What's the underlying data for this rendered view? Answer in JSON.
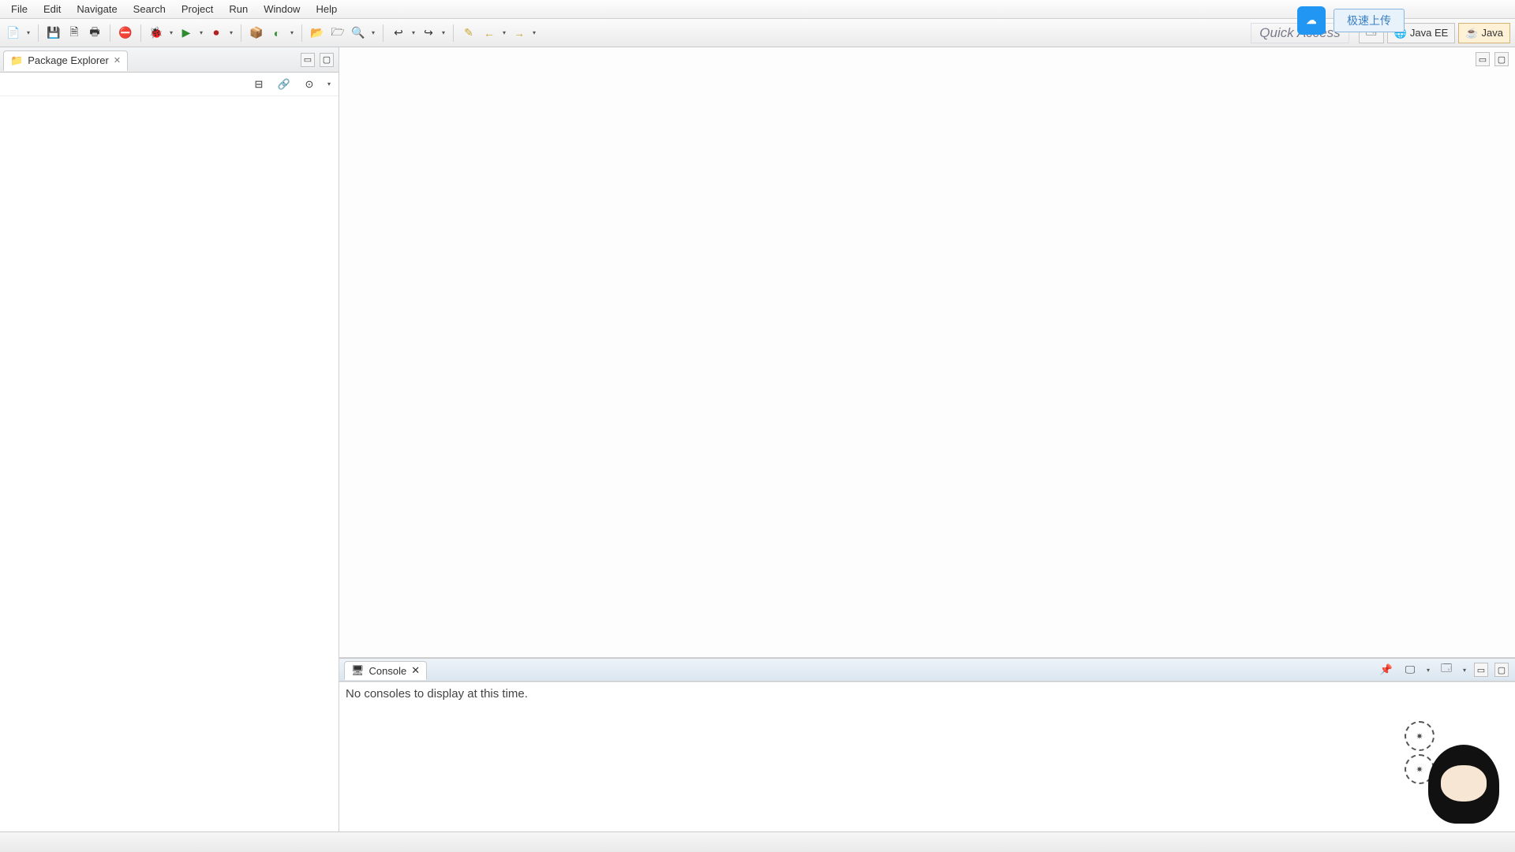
{
  "menu": [
    "File",
    "Edit",
    "Navigate",
    "Search",
    "Project",
    "Run",
    "Window",
    "Help"
  ],
  "upload": {
    "label": "极速上传"
  },
  "quickAccess": {
    "placeholder": "Quick Access"
  },
  "perspectives": [
    {
      "id": "open",
      "label": ""
    },
    {
      "id": "javaee",
      "label": "Java EE"
    },
    {
      "id": "java",
      "label": "Java"
    }
  ],
  "packageExplorer": {
    "title": "Package Explorer"
  },
  "console": {
    "title": "Console",
    "message": "No consoles to display at this time."
  }
}
